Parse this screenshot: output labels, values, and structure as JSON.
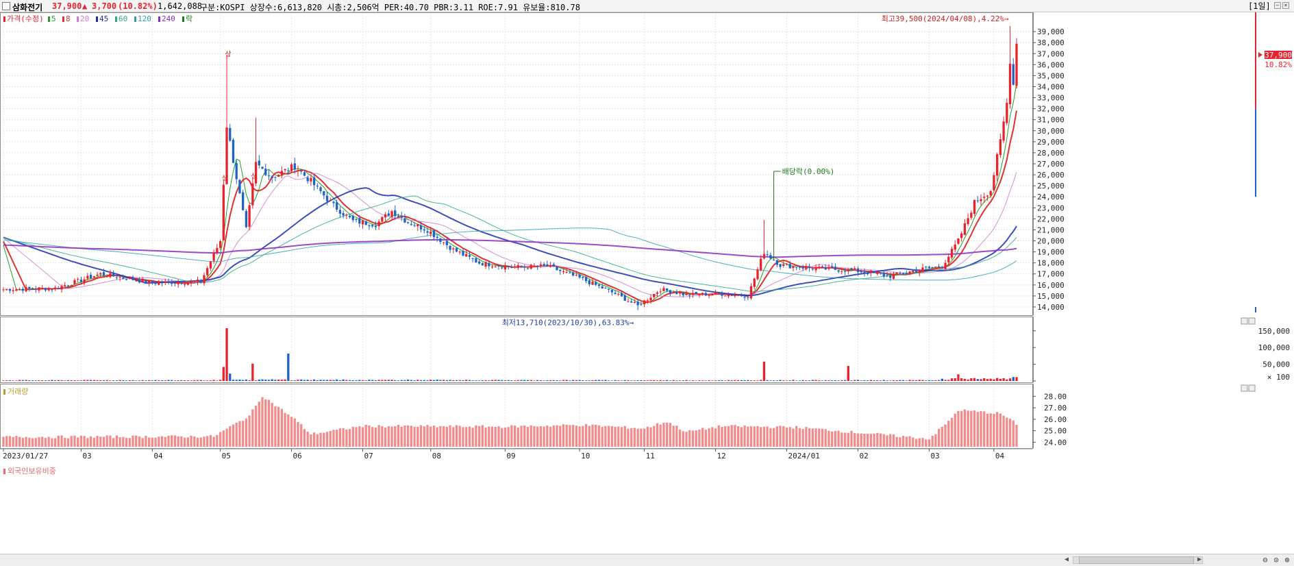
{
  "header": {
    "stock_name": "삼화전기",
    "price": "37,900",
    "change_arrow": "▲",
    "change": "3,700",
    "change_pct": "(10.82%)",
    "volume": "1,642,088",
    "info": "구분:KOSPI 상장수:6,613,820 시총:2,506억 PER:40.70 PBR:3.11 ROE:7.91 유보율:810.78",
    "period_label": "[1일]"
  },
  "legend": {
    "price_label": "가격(수정)",
    "ma_items": [
      {
        "label": "5",
        "color": "#22a022"
      },
      {
        "label": "8",
        "color": "#e03030"
      },
      {
        "label": "20",
        "color": "#d07ad0"
      },
      {
        "label": "45",
        "color": "#1a2fb0"
      },
      {
        "label": "60",
        "color": "#2aa884"
      },
      {
        "label": "120",
        "color": "#30a0b0"
      },
      {
        "label": "240",
        "color": "#8a2bbf"
      }
    ],
    "event_label": "락"
  },
  "colors": {
    "up": "#e8232e",
    "down": "#1e64c8",
    "foreign_bar": "#f28c8c",
    "grid": "#e4e4e4"
  },
  "chart_data": [
    {
      "type": "candlestick",
      "name": "price",
      "ylim": [
        13500,
        40500
      ],
      "y_ticks": [
        "14,000",
        "15,000",
        "16,000",
        "17,000",
        "18,000",
        "19,000",
        "20,000",
        "21,000",
        "22,000",
        "23,000",
        "24,000",
        "25,000",
        "26,000",
        "27,000",
        "28,000",
        "29,000",
        "30,000",
        "31,000",
        "32,000",
        "33,000",
        "34,000",
        "35,000",
        "36,000",
        "37,000",
        "38,000",
        "39,000"
      ],
      "x_ticks": [
        "2023/01/27",
        "03",
        "04",
        "05",
        "06",
        "07",
        "08",
        "09",
        "10",
        "11",
        "12",
        "2024/01",
        "02",
        "03",
        "04"
      ],
      "x_tick_dates": [
        "2023-01-27",
        "2023-03-02",
        "2023-04-03",
        "2023-05-02",
        "2023-06-01",
        "2023-07-03",
        "2023-08-01",
        "2023-09-01",
        "2023-10-04",
        "2023-11-01",
        "2023-12-01",
        "2024-01-02",
        "2024-02-01",
        "2024-03-04",
        "2024-04-01"
      ],
      "last_date": "2024-04-10",
      "current_price_label": "37,900",
      "current_pct_label": "10.82%",
      "annotations": {
        "high": "최고39,500(2024/04/08),4.22%→",
        "low": "최저13,710(2023/10/30),63.83%→",
        "dividend": "배당락(0.00%)",
        "limit_up": "상"
      },
      "anchors": [
        [
          "2023-01-27",
          15600
        ],
        [
          "2023-02-20",
          15700
        ],
        [
          "2023-03-10",
          17000
        ],
        [
          "2023-04-03",
          16200
        ],
        [
          "2023-04-24",
          16300
        ],
        [
          "2023-05-02",
          20000
        ],
        [
          "2023-05-04",
          30500
        ],
        [
          "2023-05-12",
          21000
        ],
        [
          "2023-05-17",
          27000
        ],
        [
          "2023-05-24",
          25800
        ],
        [
          "2023-06-02",
          26800
        ],
        [
          "2023-06-10",
          25400
        ],
        [
          "2023-06-20",
          23200
        ],
        [
          "2023-06-28",
          21800
        ],
        [
          "2023-07-07",
          21500
        ],
        [
          "2023-07-14",
          22700
        ],
        [
          "2023-07-21",
          21700
        ],
        [
          "2023-07-31",
          21000
        ],
        [
          "2023-08-10",
          19200
        ],
        [
          "2023-08-22",
          18000
        ],
        [
          "2023-09-05",
          17600
        ],
        [
          "2023-09-20",
          17700
        ],
        [
          "2023-10-05",
          16500
        ],
        [
          "2023-10-19",
          15200
        ],
        [
          "2023-10-30",
          14100
        ],
        [
          "2023-11-08",
          15600
        ],
        [
          "2023-11-20",
          15100
        ],
        [
          "2023-12-04",
          15200
        ],
        [
          "2023-12-15",
          15000
        ],
        [
          "2023-12-22",
          19000
        ],
        [
          "2023-12-29",
          17800
        ],
        [
          "2024-01-15",
          17500
        ],
        [
          "2024-01-31",
          17300
        ],
        [
          "2024-02-15",
          16800
        ],
        [
          "2024-02-28",
          17400
        ],
        [
          "2024-03-08",
          17700
        ],
        [
          "2024-03-15",
          20000
        ],
        [
          "2024-03-22",
          23500
        ],
        [
          "2024-03-29",
          24600
        ],
        [
          "2024-04-03",
          29000
        ],
        [
          "2024-04-05",
          32500
        ],
        [
          "2024-04-08",
          36500
        ],
        [
          "2024-04-09",
          34200
        ],
        [
          "2024-04-10",
          37900
        ]
      ],
      "moving_averages": [
        {
          "name": "5",
          "color": "#22a022"
        },
        {
          "name": "8",
          "color": "#e03030"
        },
        {
          "name": "20",
          "color": "#d07ad0"
        },
        {
          "name": "45",
          "color": "#1a2fb0"
        },
        {
          "name": "60",
          "color": "#2aa884"
        },
        {
          "name": "120",
          "color": "#30a0b0"
        },
        {
          "name": "240",
          "color": "#8a2bbf"
        }
      ]
    },
    {
      "type": "bar",
      "name": "volume",
      "title": "거래량",
      "ylim": [
        0,
        170000
      ],
      "y_ticks": [
        "150,000",
        "100,000",
        "50,000",
        "× 100"
      ],
      "spikes": [
        [
          "2023-05-03",
          42000
        ],
        [
          "2023-05-04",
          158000
        ],
        [
          "2023-05-05",
          22000
        ],
        [
          "2023-05-16",
          52000
        ],
        [
          "2023-05-31",
          82000
        ],
        [
          "2023-12-22",
          58000
        ],
        [
          "2024-01-29",
          45000
        ],
        [
          "2024-03-15",
          20000
        ]
      ]
    },
    {
      "type": "bar",
      "name": "foreign_holding",
      "title": "외국인보유비중",
      "ylim": [
        23.6,
        28.5
      ],
      "y_ticks": [
        "28.00",
        "27.00",
        "26.00",
        "25.00",
        "24.00"
      ],
      "anchors": [
        [
          "2023-01-27",
          24.45
        ],
        [
          "2023-04-28",
          24.5
        ],
        [
          "2023-05-15",
          26.3
        ],
        [
          "2023-05-19",
          28.05
        ],
        [
          "2023-06-02",
          26.0
        ],
        [
          "2023-06-09",
          24.7
        ],
        [
          "2023-07-03",
          25.4
        ],
        [
          "2023-09-01",
          25.35
        ],
        [
          "2023-10-05",
          25.5
        ],
        [
          "2023-11-01",
          25.2
        ],
        [
          "2023-11-10",
          25.8
        ],
        [
          "2023-11-20",
          24.9
        ],
        [
          "2023-12-05",
          25.4
        ],
        [
          "2024-01-05",
          25.3
        ],
        [
          "2024-03-04",
          24.3
        ],
        [
          "2024-03-12",
          25.8
        ],
        [
          "2024-03-15",
          26.8
        ],
        [
          "2024-04-03",
          26.5
        ],
        [
          "2024-04-10",
          25.6
        ]
      ]
    }
  ]
}
